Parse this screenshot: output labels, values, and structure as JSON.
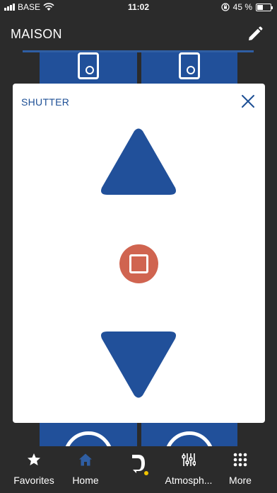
{
  "status_bar": {
    "carrier": "BASE",
    "time": "11:02",
    "battery_percent": "45 %",
    "battery_level": 0.45
  },
  "header": {
    "title": "MAISON",
    "edit_icon": "pencil-icon"
  },
  "modal": {
    "title": "SHUTTER",
    "close_icon": "close-icon",
    "up_icon": "triangle-up-icon",
    "stop_icon": "stop-icon",
    "down_icon": "triangle-down-icon",
    "colors": {
      "accent": "#21509a",
      "stop": "#d06450"
    }
  },
  "tabs": [
    {
      "label": "Favorites",
      "icon": "star-icon"
    },
    {
      "label": "Home",
      "icon": "home-icon",
      "active": true
    },
    {
      "label": "",
      "icon": "brand-logo-icon"
    },
    {
      "label": "Atmosph...",
      "icon": "sliders-icon"
    },
    {
      "label": "More",
      "icon": "grid-dots-icon"
    }
  ]
}
